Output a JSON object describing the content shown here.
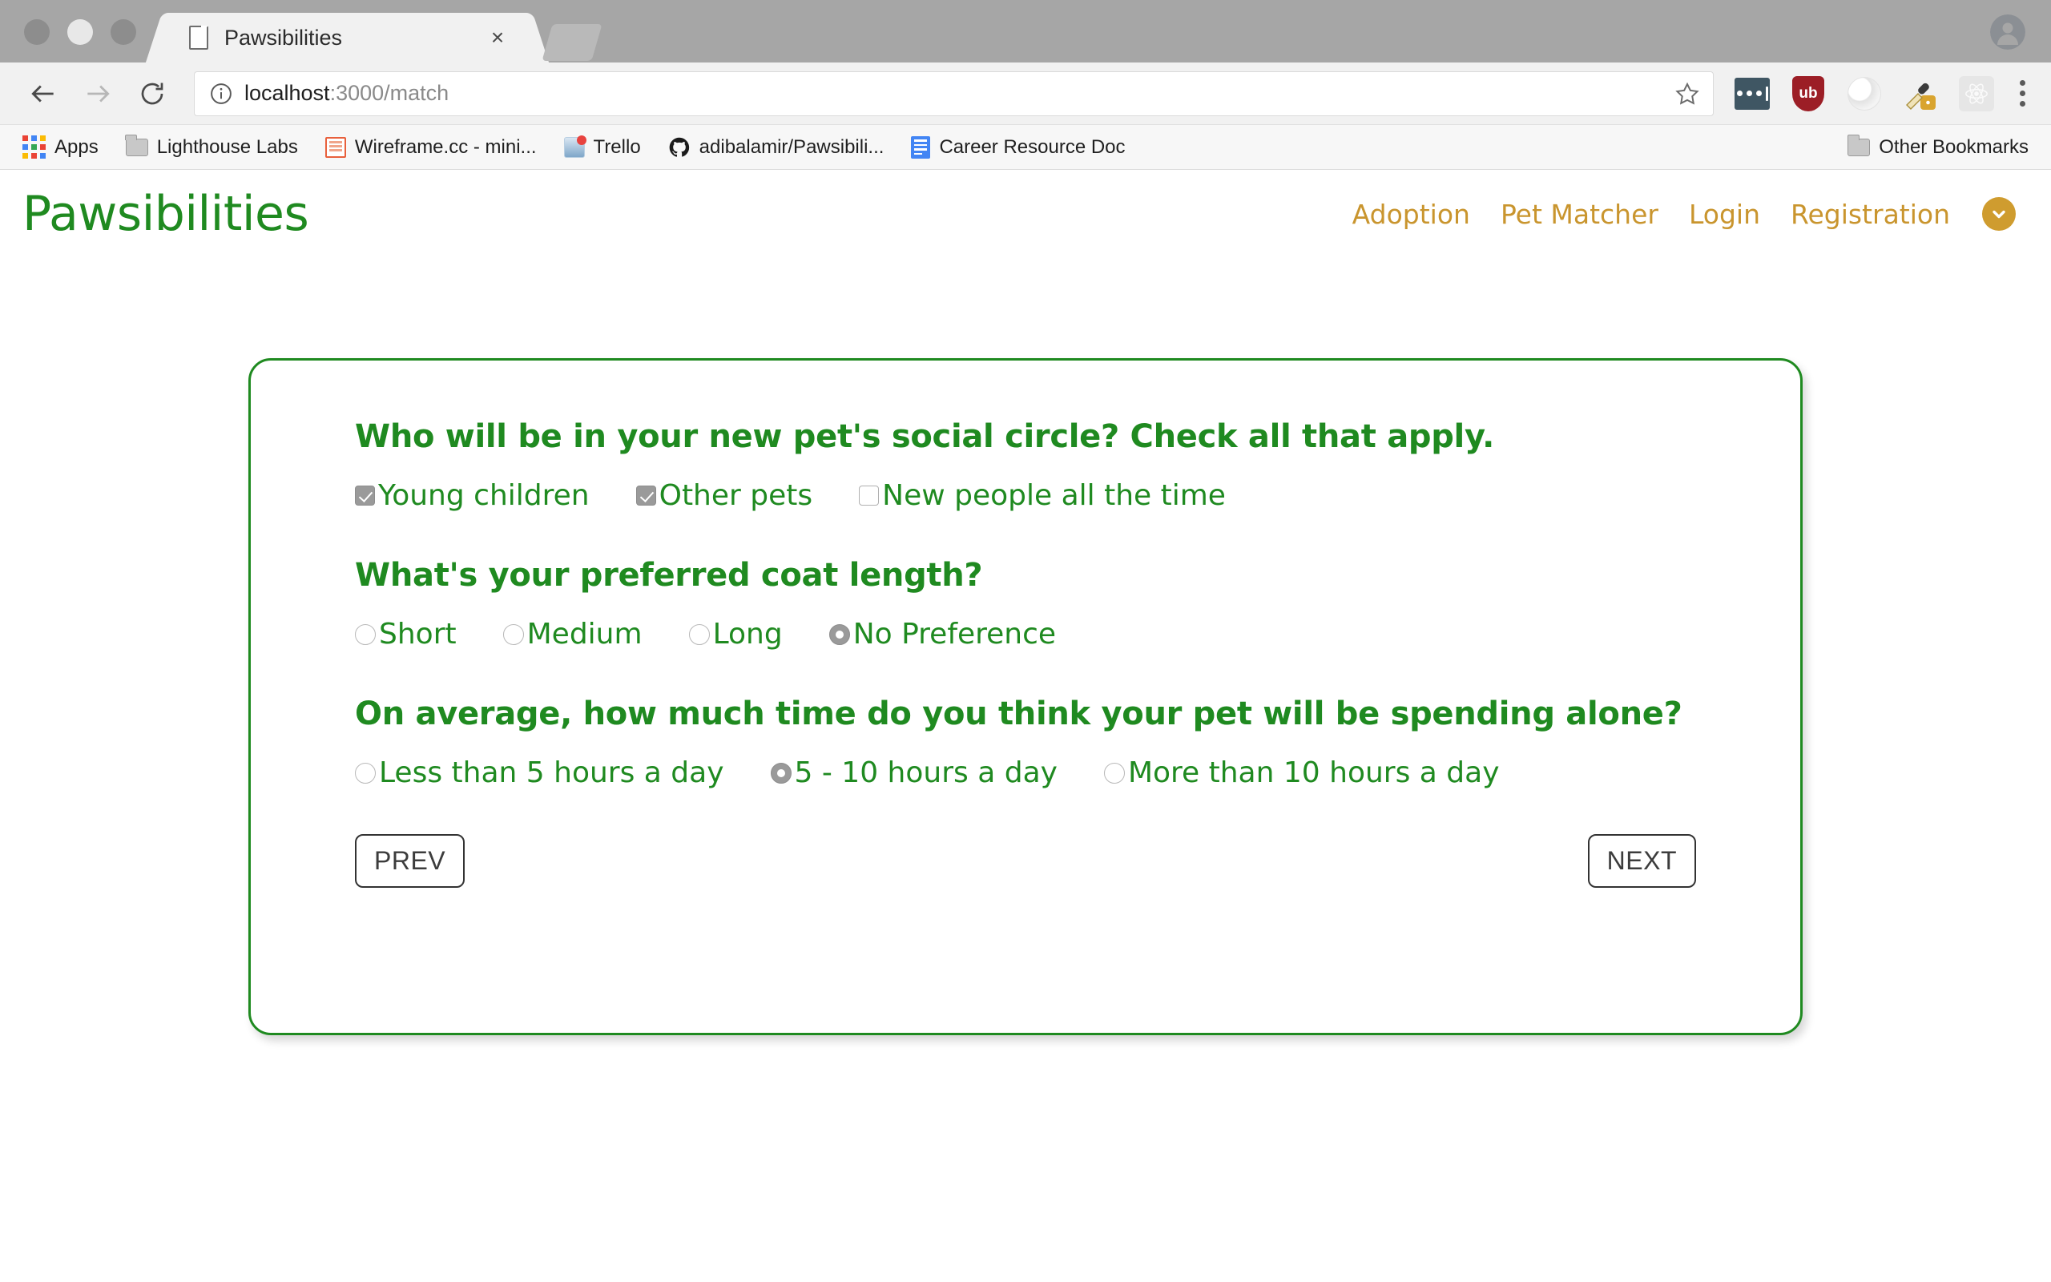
{
  "browser": {
    "tab": {
      "title": "Pawsibilities",
      "favicon": "document-icon",
      "close": "×"
    },
    "omnibox": {
      "url_host": "localhost",
      "url_rest": ":3000/match",
      "info_icon": "info-circle-icon",
      "star_icon": "bookmark-star-icon"
    },
    "extensions": [
      {
        "name": "lastpass-extension"
      },
      {
        "name": "ublock-origin-extension",
        "label": "ub"
      },
      {
        "name": "light-circle-extension"
      },
      {
        "name": "eyedropper-extension"
      },
      {
        "name": "react-devtools-extension"
      }
    ],
    "menu": "chrome-menu-icon",
    "bookmarks": [
      {
        "label": "Apps",
        "icon": "apps-grid-icon"
      },
      {
        "label": "Lighthouse Labs",
        "icon": "folder-icon"
      },
      {
        "label": "Wireframe.cc - mini...",
        "icon": "wireframe-icon"
      },
      {
        "label": "Trello",
        "icon": "trello-icon"
      },
      {
        "label": "adibalamir/Pawsibili...",
        "icon": "github-icon"
      },
      {
        "label": "Career Resource Doc",
        "icon": "google-docs-icon"
      }
    ],
    "other_bookmarks": {
      "label": "Other Bookmarks",
      "icon": "folder-icon"
    },
    "profile": "profile-avatar-icon"
  },
  "site": {
    "logo": "Pawsibilities",
    "nav": [
      {
        "label": "Adoption"
      },
      {
        "label": "Pet Matcher"
      },
      {
        "label": "Login"
      },
      {
        "label": "Registration"
      }
    ],
    "nav_chevron": "chevron-down-icon"
  },
  "form": {
    "questions": [
      {
        "title": "Who will be in your new pet's social circle? Check all that apply.",
        "type": "checkbox",
        "options": [
          {
            "label": "Young children",
            "checked": true
          },
          {
            "label": "Other pets",
            "checked": true
          },
          {
            "label": "New people all the time",
            "checked": false
          }
        ]
      },
      {
        "title": "What's your preferred coat length?",
        "type": "radio",
        "options": [
          {
            "label": "Short",
            "checked": false
          },
          {
            "label": "Medium",
            "checked": false
          },
          {
            "label": "Long",
            "checked": false
          },
          {
            "label": "No Preference",
            "checked": true
          }
        ]
      },
      {
        "title": "On average, how much time do you think your pet will be spending alone?",
        "type": "radio",
        "options": [
          {
            "label": "Less than 5 hours a day",
            "checked": false
          },
          {
            "label": "5 - 10 hours a day",
            "checked": true
          },
          {
            "label": "More than 10 hours a day",
            "checked": false
          }
        ]
      }
    ],
    "prev_label": "PREV",
    "next_label": "NEXT"
  },
  "colors": {
    "brand_green": "#1f8a20",
    "nav_gold": "#c9952e",
    "chevron_gold": "#cf9c2f"
  }
}
